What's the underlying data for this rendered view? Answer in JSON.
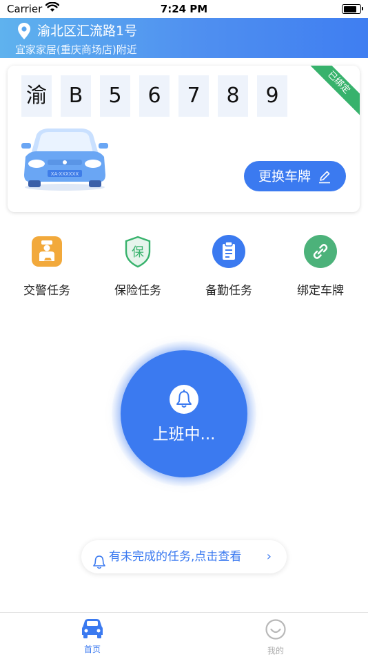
{
  "status_bar": {
    "carrier": "Carrier",
    "time": "7:24 PM"
  },
  "header": {
    "address": "渝北区汇流路1号",
    "nearby": "宜家家居(重庆商场店)附近"
  },
  "plate_card": {
    "characters": [
      "渝",
      "B",
      "5",
      "6",
      "7",
      "8",
      "9"
    ],
    "status_ribbon": "已绑定",
    "change_plate_label": "更换车牌",
    "car_plate_text": "XA-XXXXXX"
  },
  "quick_tasks": [
    {
      "label": "交警任务",
      "icon": "traffic-police-icon",
      "color": "#f2a93b"
    },
    {
      "label": "保险任务",
      "icon": "insurance-shield-icon",
      "color": "#37b26c"
    },
    {
      "label": "备勤任务",
      "icon": "clipboard-icon",
      "color": "#3b7af0"
    },
    {
      "label": "绑定车牌",
      "icon": "link-icon",
      "color": "#4cb27a"
    }
  ],
  "duty_button": {
    "label": "上班中..."
  },
  "pending_notice": {
    "text": "有未完成的任务,点击查看"
  },
  "tab_bar": {
    "tabs": [
      {
        "label": "首页",
        "icon": "car-icon",
        "active": true
      },
      {
        "label": "我的",
        "icon": "smiley-icon",
        "active": false
      }
    ]
  },
  "colors": {
    "accent": "#3b7af0",
    "bound_green": "#37b26c"
  }
}
